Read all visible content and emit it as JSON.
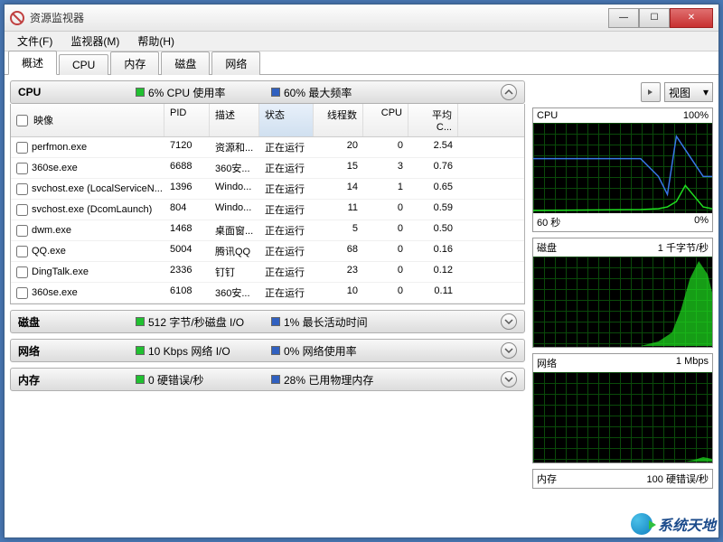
{
  "window_title": "资源监视器",
  "menu": {
    "file": "文件(F)",
    "monitor": "监视器(M)",
    "help": "帮助(H)"
  },
  "tabs": [
    "概述",
    "CPU",
    "内存",
    "磁盘",
    "网络"
  ],
  "active_tab": 0,
  "cpu_section": {
    "label": "CPU",
    "usage": "6% CPU 使用率",
    "freq": "60% 最大频率",
    "usage_color": "#20c030",
    "freq_color": "#3060c0"
  },
  "columns": {
    "image": "映像",
    "pid": "PID",
    "desc": "描述",
    "status": "状态",
    "threads": "线程数",
    "cpu": "CPU",
    "avg": "平均 C..."
  },
  "processes": [
    {
      "image": "perfmon.exe",
      "pid": "7120",
      "desc": "资源和...",
      "status": "正在运行",
      "threads": "20",
      "cpu": "0",
      "avg": "2.54"
    },
    {
      "image": "360se.exe",
      "pid": "6688",
      "desc": "360安...",
      "status": "正在运行",
      "threads": "15",
      "cpu": "3",
      "avg": "0.76"
    },
    {
      "image": "svchost.exe (LocalServiceN...",
      "pid": "1396",
      "desc": "Windo...",
      "status": "正在运行",
      "threads": "14",
      "cpu": "1",
      "avg": "0.65"
    },
    {
      "image": "svchost.exe (DcomLaunch)",
      "pid": "804",
      "desc": "Windo...",
      "status": "正在运行",
      "threads": "11",
      "cpu": "0",
      "avg": "0.59"
    },
    {
      "image": "dwm.exe",
      "pid": "1468",
      "desc": "桌面窗...",
      "status": "正在运行",
      "threads": "5",
      "cpu": "0",
      "avg": "0.50"
    },
    {
      "image": "QQ.exe",
      "pid": "5004",
      "desc": "腾讯QQ",
      "status": "正在运行",
      "threads": "68",
      "cpu": "0",
      "avg": "0.16"
    },
    {
      "image": "DingTalk.exe",
      "pid": "2336",
      "desc": "钉钉",
      "status": "正在运行",
      "threads": "23",
      "cpu": "0",
      "avg": "0.12"
    },
    {
      "image": "360se.exe",
      "pid": "6108",
      "desc": "360安...",
      "status": "正在运行",
      "threads": "10",
      "cpu": "0",
      "avg": "0.11"
    }
  ],
  "disk_section": {
    "label": "磁盘",
    "io": "512 字节/秒磁盘 I/O",
    "active": "1% 最长活动时间",
    "io_color": "#20c030",
    "active_color": "#3060c0"
  },
  "net_section": {
    "label": "网络",
    "io": "10 Kbps 网络 I/O",
    "util": "0% 网络使用率",
    "io_color": "#20c030",
    "util_color": "#3060c0"
  },
  "mem_section": {
    "label": "内存",
    "faults": "0 硬错误/秒",
    "used": "28% 已用物理内存",
    "faults_color": "#20c030",
    "used_color": "#3060c0"
  },
  "view_label": "视图",
  "graphs": {
    "cpu": {
      "title": "CPU",
      "right": "100%",
      "foot_l": "60 秒",
      "foot_r": "0%"
    },
    "disk": {
      "title": "磁盘",
      "right": "1 千字节/秒"
    },
    "net": {
      "title": "网络",
      "right": "1 Mbps"
    },
    "mem": {
      "title": "内存",
      "right": "100 硬错误/秒"
    }
  },
  "watermark": "系统天地",
  "chart_data": [
    {
      "type": "line",
      "title": "CPU",
      "ylim": [
        0,
        100
      ],
      "xlabel": "60 秒",
      "series": [
        {
          "name": "max_freq",
          "color": "#3878e8",
          "values": [
            60,
            60,
            60,
            60,
            60,
            60,
            60,
            60,
            60,
            40,
            20,
            85,
            70,
            55,
            40
          ]
        },
        {
          "name": "cpu_usage",
          "color": "#20e020",
          "values": [
            2,
            2,
            2,
            2,
            2,
            2,
            3,
            3,
            4,
            5,
            8,
            12,
            30,
            18,
            6
          ]
        }
      ]
    },
    {
      "type": "area",
      "title": "磁盘",
      "ylabel": "千字节/秒",
      "ylim": [
        0,
        1
      ],
      "series": [
        {
          "name": "disk_io",
          "color": "#20e020",
          "values": [
            0,
            0,
            0,
            0,
            0,
            0,
            0.02,
            0.05,
            0.1,
            0.2,
            0.4,
            0.7,
            0.95,
            0.8,
            0.6
          ]
        }
      ]
    },
    {
      "type": "area",
      "title": "网络",
      "ylabel": "Mbps",
      "ylim": [
        0,
        1
      ],
      "series": [
        {
          "name": "net_io",
          "color": "#20e020",
          "values": [
            0,
            0,
            0,
            0,
            0,
            0,
            0,
            0,
            0,
            0,
            0,
            0,
            0.02,
            0.05,
            0.03
          ]
        }
      ]
    },
    {
      "type": "line",
      "title": "内存",
      "ylabel": "硬错误/秒",
      "ylim": [
        0,
        100
      ],
      "series": [
        {
          "name": "hard_faults",
          "color": "#20e020",
          "values": [
            0,
            0,
            0,
            0,
            0,
            0,
            0,
            0,
            0,
            0,
            0,
            0,
            0,
            0,
            0
          ]
        }
      ]
    }
  ]
}
